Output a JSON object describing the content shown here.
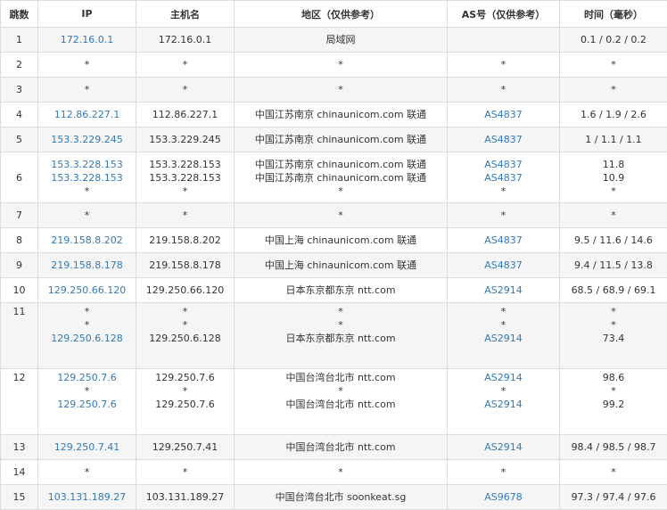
{
  "headers": [
    "跳数",
    "IP",
    "主机名",
    "地区（仅供参考）",
    "AS号（仅供参考）",
    "时间（毫秒）"
  ],
  "rows": [
    {
      "hop": "1",
      "ip": [
        "172.16.0.1"
      ],
      "host": [
        "172.16.0.1"
      ],
      "region": [
        "局域网"
      ],
      "as": [
        ""
      ],
      "time": [
        "0.1 / 0.2 / 0.2"
      ]
    },
    {
      "hop": "2",
      "ip": [
        "*"
      ],
      "host": [
        "*"
      ],
      "region": [
        "*"
      ],
      "as": [
        "*"
      ],
      "time": [
        "*"
      ]
    },
    {
      "hop": "3",
      "ip": [
        "*"
      ],
      "host": [
        "*"
      ],
      "region": [
        "*"
      ],
      "as": [
        "*"
      ],
      "time": [
        "*"
      ]
    },
    {
      "hop": "4",
      "ip": [
        "112.86.227.1"
      ],
      "host": [
        "112.86.227.1"
      ],
      "region": [
        "中国江苏南京 chinaunicom.com 联通"
      ],
      "as": [
        "AS4837"
      ],
      "time": [
        "1.6 / 1.9 / 2.6"
      ]
    },
    {
      "hop": "5",
      "ip": [
        "153.3.229.245"
      ],
      "host": [
        "153.3.229.245"
      ],
      "region": [
        "中国江苏南京 chinaunicom.com 联通"
      ],
      "as": [
        "AS4837"
      ],
      "time": [
        "1 / 1.1 / 1.1"
      ]
    },
    {
      "hop": "6",
      "ip": [
        "153.3.228.153",
        "153.3.228.153",
        "*"
      ],
      "host": [
        "153.3.228.153",
        "153.3.228.153",
        "*"
      ],
      "region": [
        "中国江苏南京 chinaunicom.com 联通",
        "中国江苏南京 chinaunicom.com 联通",
        "*"
      ],
      "as": [
        "AS4837",
        "AS4837",
        "*"
      ],
      "time": [
        "11.8",
        "10.9",
        "*"
      ]
    },
    {
      "hop": "7",
      "ip": [
        "*"
      ],
      "host": [
        "*"
      ],
      "region": [
        "*"
      ],
      "as": [
        "*"
      ],
      "time": [
        "*"
      ]
    },
    {
      "hop": "8",
      "ip": [
        "219.158.8.202"
      ],
      "host": [
        "219.158.8.202"
      ],
      "region": [
        "中国上海 chinaunicom.com 联通"
      ],
      "as": [
        "AS4837"
      ],
      "time": [
        "9.5 / 11.6 / 14.6"
      ]
    },
    {
      "hop": "9",
      "ip": [
        "219.158.8.178"
      ],
      "host": [
        "219.158.8.178"
      ],
      "region": [
        "中国上海 chinaunicom.com 联通"
      ],
      "as": [
        "AS4837"
      ],
      "time": [
        "9.4 / 11.5 / 13.8"
      ]
    },
    {
      "hop": "10",
      "ip": [
        "129.250.66.120"
      ],
      "host": [
        "129.250.66.120"
      ],
      "region": [
        "日本东京都东京 ntt.com"
      ],
      "as": [
        "AS2914"
      ],
      "time": [
        "68.5 / 68.9 / 69.1"
      ]
    },
    {
      "hop": "11",
      "ip": [
        "*",
        "*",
        "129.250.6.128"
      ],
      "host": [
        "*",
        "*",
        "129.250.6.128"
      ],
      "region": [
        "*",
        "*",
        "日本东京都东京 ntt.com"
      ],
      "as": [
        "*",
        "*",
        "AS2914"
      ],
      "time": [
        "*",
        "*",
        "73.4"
      ]
    },
    {
      "hop": "12",
      "ip": [
        "129.250.7.6",
        "*",
        "129.250.7.6"
      ],
      "host": [
        "129.250.7.6",
        "*",
        "129.250.7.6"
      ],
      "region": [
        "中国台湾台北市 ntt.com",
        "*",
        "中国台湾台北市 ntt.com"
      ],
      "as": [
        "AS2914",
        "*",
        "AS2914"
      ],
      "time": [
        "98.6",
        "*",
        "99.2"
      ]
    },
    {
      "hop": "13",
      "ip": [
        "129.250.7.41"
      ],
      "host": [
        "129.250.7.41"
      ],
      "region": [
        "中国台湾台北市 ntt.com"
      ],
      "as": [
        "AS2914"
      ],
      "time": [
        "98.4 / 98.5 / 98.7"
      ]
    },
    {
      "hop": "14",
      "ip": [
        "*"
      ],
      "host": [
        "*"
      ],
      "region": [
        "*"
      ],
      "as": [
        "*"
      ],
      "time": [
        "*"
      ]
    },
    {
      "hop": "15",
      "ip": [
        "103.131.189.27"
      ],
      "host": [
        "103.131.189.27"
      ],
      "region": [
        "中国台湾台北市 soonkeat.sg"
      ],
      "as": [
        "AS9678"
      ],
      "time": [
        "97.3 / 97.4 / 97.6"
      ]
    }
  ]
}
